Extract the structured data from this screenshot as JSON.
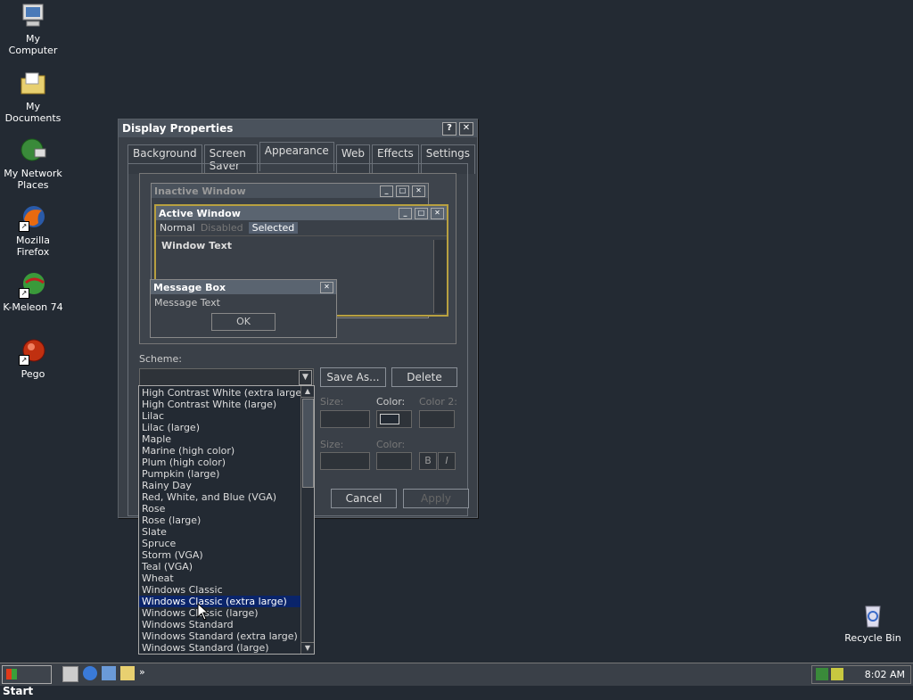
{
  "desktop": {
    "icons": [
      {
        "label": "My Computer"
      },
      {
        "label": "My Documents"
      },
      {
        "label": "My Network Places"
      },
      {
        "label": "Mozilla Firefox"
      },
      {
        "label": "K-Meleon 74"
      },
      {
        "label": "Pego"
      },
      {
        "label": "Recycle Bin"
      }
    ]
  },
  "dialog": {
    "title": "Display Properties",
    "help_button": "?",
    "close_button": "✕",
    "tabs": [
      "Background",
      "Screen Saver",
      "Appearance",
      "Web",
      "Effects",
      "Settings"
    ],
    "active_tab": "Appearance",
    "preview": {
      "inactive_title": "Inactive Window",
      "active_title": "Active Window",
      "menu": [
        "Normal",
        "Disabled",
        "Selected"
      ],
      "window_text": "Window Text",
      "message_box_title": "Message Box",
      "message_text": "Message Text",
      "ok_button": "OK"
    },
    "scheme_label": "Scheme:",
    "save_as_button": "Save As...",
    "delete_button": "Delete",
    "size_label": "Size:",
    "color_label": "Color:",
    "color2_label": "Color 2:",
    "size_label_2": "Size:",
    "color_label_2": "Color:",
    "bold_button": "B",
    "italic_button": "I",
    "cancel_button": "Cancel",
    "apply_button": "Apply"
  },
  "scheme_list": {
    "items": [
      "High Contrast White (extra large)",
      "High Contrast White (large)",
      "Lilac",
      "Lilac (large)",
      "Maple",
      "Marine (high color)",
      "Plum (high color)",
      "Pumpkin (large)",
      "Rainy Day",
      "Red, White, and Blue (VGA)",
      "Rose",
      "Rose (large)",
      "Slate",
      "Spruce",
      "Storm (VGA)",
      "Teal (VGA)",
      "Wheat",
      "Windows Classic",
      "Windows Classic (extra large)",
      "Windows Classic (large)",
      "Windows Standard",
      "Windows Standard (extra large)",
      "Windows Standard (large)"
    ],
    "selected": "Windows Classic (extra large)"
  },
  "taskbar": {
    "start_label": "Start",
    "clock": "8:02 AM"
  },
  "colors": {
    "desktop_bg": "#232a33",
    "selection": "#0a246a",
    "active_title_border": "#b8a040"
  }
}
